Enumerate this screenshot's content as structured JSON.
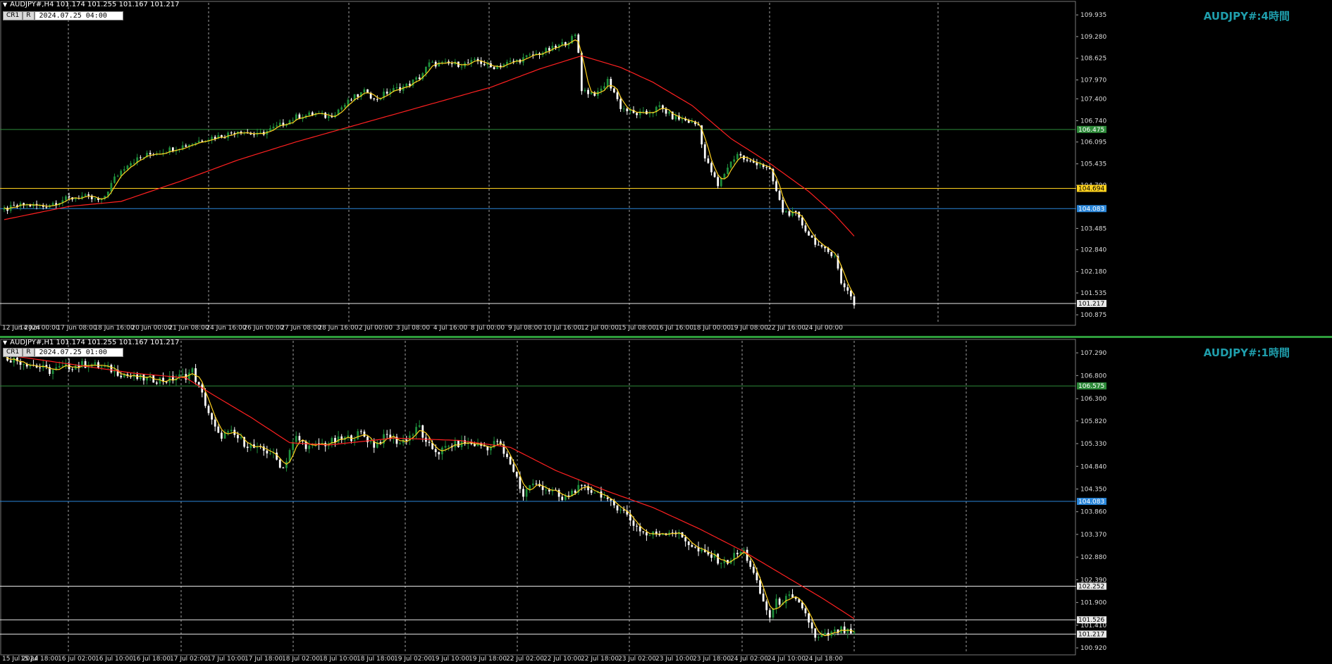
{
  "colors": {
    "background": "#000000",
    "up_candle": "#1e8f3c",
    "down_candle": "#ffffff",
    "ma_slow": "#ff2020",
    "ma_fast": "#ffd21f",
    "grid": "#c8c8c8",
    "level_green": "#2e8b3a",
    "level_yellow": "#ffd21f",
    "level_blue": "#2a86d9",
    "level_white": "#e8e8e8",
    "symbol_label": "#1f9eac"
  },
  "chart_data": [
    {
      "type": "candlestick",
      "header": "AUDJPY#,H4  101.174 101.255 101.167 101.217",
      "tag1": "CR1",
      "tag2": "R",
      "cursor_time": "2024.07.25 04:00",
      "symbol_label": "AUDJPY#:4時間",
      "ylim": [
        100.6,
        110.3
      ],
      "yticks": [
        "109.935",
        "109.280",
        "108.625",
        "107.970",
        "107.400",
        "106.740",
        "106.095",
        "105.435",
        "104.790",
        "103.485",
        "102.840",
        "102.180",
        "101.535",
        "100.875"
      ],
      "ytick_values": [
        109.935,
        109.28,
        108.625,
        107.97,
        107.4,
        106.74,
        106.095,
        105.435,
        104.79,
        103.485,
        102.84,
        102.18,
        101.535,
        100.875
      ],
      "xticks": [
        "12 Jun 2024",
        "14 Jun 00:00",
        "17 Jun 08:00",
        "18 Jun 16:00",
        "20 Jun 00:00",
        "21 Jun 08:00",
        "24 Jun 16:00",
        "26 Jun 00:00",
        "27 Jun 08:00",
        "28 Jun 16:00",
        "2 Jul 00:00",
        "3 Jul 08:00",
        "4 Jul 16:00",
        "8 Jul 00:00",
        "9 Jul 08:00",
        "10 Jul 16:00",
        "12 Jul 00:00",
        "15 Jul 08:00",
        "16 Jul 16:00",
        "18 Jul 00:00",
        "19 Jul 08:00",
        "22 Jul 16:00",
        "24 Jul 00:00"
      ],
      "levels": [
        {
          "value": 106.475,
          "label": "106.475",
          "color": "#2e8b3a"
        },
        {
          "value": 104.694,
          "label": "104.694",
          "color": "#ffd21f"
        },
        {
          "value": 104.083,
          "label": "104.083",
          "color": "#2a86d9"
        },
        {
          "value": 101.217,
          "label": "101.217",
          "color": "#e8e8e8"
        }
      ],
      "close_path": [
        [
          0,
          104.05
        ],
        [
          6,
          104.2
        ],
        [
          12,
          104.15
        ],
        [
          18,
          104.35
        ],
        [
          24,
          104.45
        ],
        [
          30,
          104.3
        ],
        [
          34,
          105.0
        ],
        [
          38,
          105.45
        ],
        [
          44,
          105.7
        ],
        [
          50,
          105.85
        ],
        [
          56,
          106.0
        ],
        [
          62,
          106.2
        ],
        [
          68,
          106.3
        ],
        [
          72,
          106.45
        ],
        [
          78,
          106.3
        ],
        [
          84,
          106.55
        ],
        [
          90,
          106.85
        ],
        [
          96,
          106.95
        ],
        [
          100,
          106.85
        ],
        [
          104,
          107.15
        ],
        [
          108,
          107.45
        ],
        [
          112,
          107.65
        ],
        [
          114,
          107.35
        ],
        [
          118,
          107.6
        ],
        [
          124,
          107.8
        ],
        [
          128,
          108.05
        ],
        [
          131,
          108.45
        ],
        [
          136,
          108.45
        ],
        [
          142,
          108.45
        ],
        [
          146,
          108.55
        ],
        [
          150,
          108.35
        ],
        [
          154,
          108.45
        ],
        [
          158,
          108.55
        ],
        [
          164,
          108.75
        ],
        [
          170,
          108.95
        ],
        [
          174,
          109.15
        ],
        [
          176,
          109.3
        ],
        [
          177,
          108.8
        ],
        [
          178,
          107.7
        ],
        [
          180,
          107.6
        ],
        [
          183,
          107.55
        ],
        [
          186,
          107.95
        ],
        [
          188,
          107.6
        ],
        [
          190,
          107.15
        ],
        [
          194,
          106.95
        ],
        [
          198,
          106.95
        ],
        [
          202,
          107.15
        ],
        [
          206,
          106.85
        ],
        [
          210,
          106.75
        ],
        [
          214,
          106.6
        ],
        [
          216,
          105.6
        ],
        [
          218,
          105.2
        ],
        [
          220,
          104.75
        ],
        [
          223,
          105.35
        ],
        [
          226,
          105.75
        ],
        [
          229,
          105.5
        ],
        [
          233,
          105.45
        ],
        [
          236,
          105.2
        ],
        [
          238,
          104.6
        ],
        [
          240,
          104.0
        ],
        [
          244,
          103.9
        ],
        [
          248,
          103.3
        ],
        [
          252,
          102.85
        ],
        [
          256,
          102.7
        ],
        [
          258,
          101.8
        ],
        [
          260,
          101.65
        ],
        [
          262,
          101.2
        ]
      ],
      "ma_slow_path": [
        [
          0,
          103.75
        ],
        [
          20,
          104.15
        ],
        [
          36,
          104.3
        ],
        [
          54,
          104.9
        ],
        [
          72,
          105.55
        ],
        [
          90,
          106.1
        ],
        [
          110,
          106.65
        ],
        [
          130,
          107.2
        ],
        [
          150,
          107.75
        ],
        [
          165,
          108.3
        ],
        [
          178,
          108.7
        ],
        [
          190,
          108.35
        ],
        [
          200,
          107.9
        ],
        [
          212,
          107.2
        ],
        [
          224,
          106.2
        ],
        [
          236,
          105.45
        ],
        [
          248,
          104.6
        ],
        [
          256,
          103.9
        ],
        [
          262,
          103.25
        ]
      ],
      "count": 263
    },
    {
      "type": "candlestick",
      "header": "AUDJPY#,H1  101.174 101.255 101.167 101.217",
      "tag1": "CR1",
      "tag2": "R",
      "cursor_time": "2024.07.25 01:00",
      "symbol_label": "AUDJPY#:1時間",
      "ylim": [
        100.8,
        107.55
      ],
      "yticks": [
        "107.290",
        "106.800",
        "106.300",
        "105.820",
        "105.330",
        "104.840",
        "104.350",
        "103.860",
        "103.370",
        "102.880",
        "102.390",
        "101.900",
        "101.410",
        "100.920"
      ],
      "ytick_values": [
        107.29,
        106.8,
        106.3,
        105.82,
        105.33,
        104.84,
        104.35,
        103.86,
        103.37,
        102.88,
        102.39,
        101.9,
        101.41,
        100.92
      ],
      "xticks": [
        "15 Jul 2024",
        "15 Jul 18:00",
        "16 Jul 02:00",
        "16 Jul 10:00",
        "16 Jul 18:00",
        "17 Jul 02:00",
        "17 Jul 10:00",
        "17 Jul 18:00",
        "18 Jul 02:00",
        "18 Jul 10:00",
        "18 Jul 18:00",
        "19 Jul 02:00",
        "19 Jul 10:00",
        "19 Jul 18:00",
        "22 Jul 02:00",
        "22 Jul 10:00",
        "22 Jul 18:00",
        "23 Jul 02:00",
        "23 Jul 10:00",
        "23 Jul 18:00",
        "24 Jul 02:00",
        "24 Jul 10:00",
        "24 Jul 18:00"
      ],
      "levels": [
        {
          "value": 106.575,
          "label": "106.575",
          "color": "#2e8b3a"
        },
        {
          "value": 104.083,
          "label": "104.083",
          "color": "#2a86d9"
        },
        {
          "value": 102.252,
          "label": "102.252",
          "color": "#e8e8e8"
        },
        {
          "value": 101.526,
          "label": "101.526",
          "color": "#e8e8e8"
        },
        {
          "value": 101.217,
          "label": "101.217",
          "color": "#e8e8e8"
        }
      ],
      "close_path": [
        [
          0,
          107.2
        ],
        [
          8,
          107.05
        ],
        [
          14,
          106.9
        ],
        [
          20,
          107.0
        ],
        [
          26,
          107.05
        ],
        [
          32,
          106.95
        ],
        [
          40,
          106.75
        ],
        [
          50,
          106.7
        ],
        [
          56,
          106.8
        ],
        [
          58,
          106.9
        ],
        [
          60,
          106.55
        ],
        [
          62,
          106.2
        ],
        [
          64,
          105.8
        ],
        [
          66,
          105.5
        ],
        [
          70,
          105.55
        ],
        [
          74,
          105.35
        ],
        [
          78,
          105.2
        ],
        [
          82,
          105.15
        ],
        [
          86,
          104.8
        ],
        [
          88,
          105.2
        ],
        [
          90,
          105.45
        ],
        [
          94,
          105.25
        ],
        [
          100,
          105.35
        ],
        [
          106,
          105.45
        ],
        [
          110,
          105.55
        ],
        [
          114,
          105.3
        ],
        [
          118,
          105.5
        ],
        [
          122,
          105.35
        ],
        [
          126,
          105.55
        ],
        [
          128,
          105.7
        ],
        [
          130,
          105.3
        ],
        [
          134,
          105.15
        ],
        [
          138,
          105.3
        ],
        [
          142,
          105.35
        ],
        [
          146,
          105.3
        ],
        [
          150,
          105.25
        ],
        [
          152,
          105.4
        ],
        [
          154,
          105.1
        ],
        [
          156,
          104.9
        ],
        [
          158,
          104.6
        ],
        [
          160,
          104.2
        ],
        [
          162,
          104.45
        ],
        [
          166,
          104.4
        ],
        [
          170,
          104.25
        ],
        [
          172,
          104.1
        ],
        [
          176,
          104.35
        ],
        [
          180,
          104.35
        ],
        [
          184,
          104.25
        ],
        [
          186,
          104.05
        ],
        [
          190,
          103.95
        ],
        [
          194,
          103.6
        ],
        [
          198,
          103.35
        ],
        [
          202,
          103.4
        ],
        [
          206,
          103.45
        ],
        [
          210,
          103.25
        ],
        [
          214,
          103.0
        ],
        [
          218,
          102.9
        ],
        [
          222,
          102.75
        ],
        [
          226,
          102.95
        ],
        [
          228,
          103.0
        ],
        [
          230,
          102.7
        ],
        [
          232,
          102.3
        ],
        [
          234,
          101.9
        ],
        [
          236,
          101.6
        ],
        [
          238,
          101.9
        ],
        [
          242,
          102.0
        ],
        [
          246,
          101.8
        ],
        [
          248,
          101.5
        ],
        [
          250,
          101.1
        ],
        [
          254,
          101.2
        ],
        [
          258,
          101.3
        ],
        [
          262,
          101.2
        ]
      ],
      "ma_slow_path": [
        [
          0,
          107.25
        ],
        [
          20,
          107.05
        ],
        [
          40,
          106.85
        ],
        [
          56,
          106.75
        ],
        [
          64,
          106.4
        ],
        [
          76,
          105.9
        ],
        [
          88,
          105.35
        ],
        [
          100,
          105.3
        ],
        [
          120,
          105.45
        ],
        [
          140,
          105.4
        ],
        [
          156,
          105.25
        ],
        [
          170,
          104.75
        ],
        [
          186,
          104.3
        ],
        [
          200,
          103.95
        ],
        [
          214,
          103.5
        ],
        [
          228,
          103.0
        ],
        [
          240,
          102.5
        ],
        [
          252,
          102.0
        ],
        [
          262,
          101.55
        ]
      ],
      "count": 263
    }
  ]
}
